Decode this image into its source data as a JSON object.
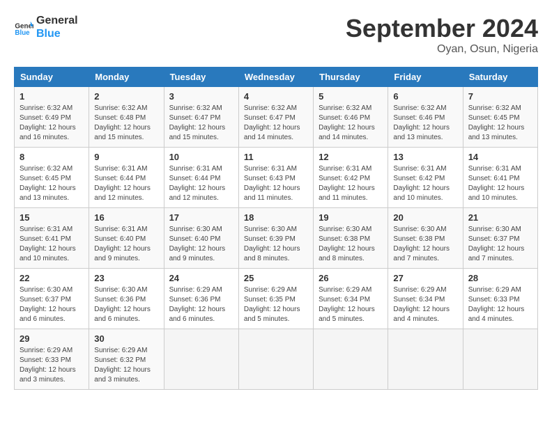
{
  "header": {
    "logo_line1": "General",
    "logo_line2": "Blue",
    "month": "September 2024",
    "location": "Oyan, Osun, Nigeria"
  },
  "days_of_week": [
    "Sunday",
    "Monday",
    "Tuesday",
    "Wednesday",
    "Thursday",
    "Friday",
    "Saturday"
  ],
  "weeks": [
    [
      {
        "day": "1",
        "info": "Sunrise: 6:32 AM\nSunset: 6:49 PM\nDaylight: 12 hours\nand 16 minutes."
      },
      {
        "day": "2",
        "info": "Sunrise: 6:32 AM\nSunset: 6:48 PM\nDaylight: 12 hours\nand 15 minutes."
      },
      {
        "day": "3",
        "info": "Sunrise: 6:32 AM\nSunset: 6:47 PM\nDaylight: 12 hours\nand 15 minutes."
      },
      {
        "day": "4",
        "info": "Sunrise: 6:32 AM\nSunset: 6:47 PM\nDaylight: 12 hours\nand 14 minutes."
      },
      {
        "day": "5",
        "info": "Sunrise: 6:32 AM\nSunset: 6:46 PM\nDaylight: 12 hours\nand 14 minutes."
      },
      {
        "day": "6",
        "info": "Sunrise: 6:32 AM\nSunset: 6:46 PM\nDaylight: 12 hours\nand 13 minutes."
      },
      {
        "day": "7",
        "info": "Sunrise: 6:32 AM\nSunset: 6:45 PM\nDaylight: 12 hours\nand 13 minutes."
      }
    ],
    [
      {
        "day": "8",
        "info": "Sunrise: 6:32 AM\nSunset: 6:45 PM\nDaylight: 12 hours\nand 13 minutes."
      },
      {
        "day": "9",
        "info": "Sunrise: 6:31 AM\nSunset: 6:44 PM\nDaylight: 12 hours\nand 12 minutes."
      },
      {
        "day": "10",
        "info": "Sunrise: 6:31 AM\nSunset: 6:44 PM\nDaylight: 12 hours\nand 12 minutes."
      },
      {
        "day": "11",
        "info": "Sunrise: 6:31 AM\nSunset: 6:43 PM\nDaylight: 12 hours\nand 11 minutes."
      },
      {
        "day": "12",
        "info": "Sunrise: 6:31 AM\nSunset: 6:42 PM\nDaylight: 12 hours\nand 11 minutes."
      },
      {
        "day": "13",
        "info": "Sunrise: 6:31 AM\nSunset: 6:42 PM\nDaylight: 12 hours\nand 10 minutes."
      },
      {
        "day": "14",
        "info": "Sunrise: 6:31 AM\nSunset: 6:41 PM\nDaylight: 12 hours\nand 10 minutes."
      }
    ],
    [
      {
        "day": "15",
        "info": "Sunrise: 6:31 AM\nSunset: 6:41 PM\nDaylight: 12 hours\nand 10 minutes."
      },
      {
        "day": "16",
        "info": "Sunrise: 6:31 AM\nSunset: 6:40 PM\nDaylight: 12 hours\nand 9 minutes."
      },
      {
        "day": "17",
        "info": "Sunrise: 6:30 AM\nSunset: 6:40 PM\nDaylight: 12 hours\nand 9 minutes."
      },
      {
        "day": "18",
        "info": "Sunrise: 6:30 AM\nSunset: 6:39 PM\nDaylight: 12 hours\nand 8 minutes."
      },
      {
        "day": "19",
        "info": "Sunrise: 6:30 AM\nSunset: 6:38 PM\nDaylight: 12 hours\nand 8 minutes."
      },
      {
        "day": "20",
        "info": "Sunrise: 6:30 AM\nSunset: 6:38 PM\nDaylight: 12 hours\nand 7 minutes."
      },
      {
        "day": "21",
        "info": "Sunrise: 6:30 AM\nSunset: 6:37 PM\nDaylight: 12 hours\nand 7 minutes."
      }
    ],
    [
      {
        "day": "22",
        "info": "Sunrise: 6:30 AM\nSunset: 6:37 PM\nDaylight: 12 hours\nand 6 minutes."
      },
      {
        "day": "23",
        "info": "Sunrise: 6:30 AM\nSunset: 6:36 PM\nDaylight: 12 hours\nand 6 minutes."
      },
      {
        "day": "24",
        "info": "Sunrise: 6:29 AM\nSunset: 6:36 PM\nDaylight: 12 hours\nand 6 minutes."
      },
      {
        "day": "25",
        "info": "Sunrise: 6:29 AM\nSunset: 6:35 PM\nDaylight: 12 hours\nand 5 minutes."
      },
      {
        "day": "26",
        "info": "Sunrise: 6:29 AM\nSunset: 6:34 PM\nDaylight: 12 hours\nand 5 minutes."
      },
      {
        "day": "27",
        "info": "Sunrise: 6:29 AM\nSunset: 6:34 PM\nDaylight: 12 hours\nand 4 minutes."
      },
      {
        "day": "28",
        "info": "Sunrise: 6:29 AM\nSunset: 6:33 PM\nDaylight: 12 hours\nand 4 minutes."
      }
    ],
    [
      {
        "day": "29",
        "info": "Sunrise: 6:29 AM\nSunset: 6:33 PM\nDaylight: 12 hours\nand 3 minutes."
      },
      {
        "day": "30",
        "info": "Sunrise: 6:29 AM\nSunset: 6:32 PM\nDaylight: 12 hours\nand 3 minutes."
      },
      {
        "day": "",
        "info": ""
      },
      {
        "day": "",
        "info": ""
      },
      {
        "day": "",
        "info": ""
      },
      {
        "day": "",
        "info": ""
      },
      {
        "day": "",
        "info": ""
      }
    ]
  ]
}
